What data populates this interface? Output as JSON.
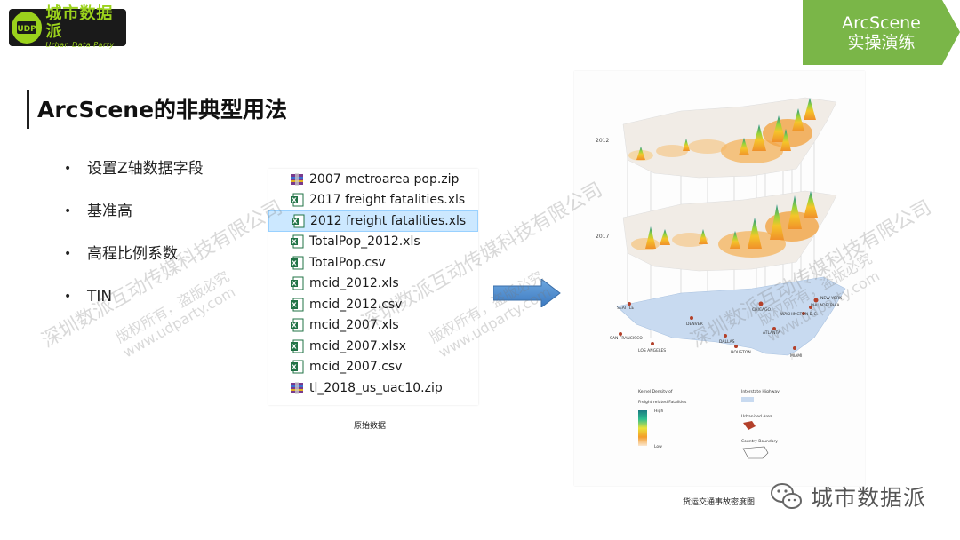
{
  "logo": {
    "cn": "城市数据派",
    "en": "Urban Data Party",
    "mark": "UDP"
  },
  "tag": {
    "line1": "ArcScene",
    "line2": "实操演练",
    "color": "#7ab648"
  },
  "title": "ArcScene的非典型用法",
  "bullets": [
    "设置Z轴数据字段",
    "基准高",
    "高程比例系数",
    "TIN"
  ],
  "files": [
    {
      "name": "2007 metroarea pop.zip",
      "icon": "winrar-icon"
    },
    {
      "name": "2017 freight fatalities.xls",
      "icon": "excel-icon"
    },
    {
      "name": "2012 freight fatalities.xls",
      "icon": "excel-icon",
      "selected": true
    },
    {
      "name": "TotalPop_2012.xls",
      "icon": "excel-icon"
    },
    {
      "name": "TotalPop.csv",
      "icon": "excel-csv-icon"
    },
    {
      "name": "mcid_2012.xls",
      "icon": "excel-icon"
    },
    {
      "name": "mcid_2012.csv",
      "icon": "excel-csv-icon"
    },
    {
      "name": "mcid_2007.xls",
      "icon": "excel-icon"
    },
    {
      "name": "mcid_2007.xlsx",
      "icon": "excel-csv-icon"
    },
    {
      "name": "mcid_2007.csv",
      "icon": "excel-csv-icon"
    },
    {
      "name": "tl_2018_us_uac10.zip",
      "icon": "winrar-icon"
    }
  ],
  "caption_left": "原始数据",
  "caption_right": "货运交通事故密度图",
  "map": {
    "layer_years": [
      "2012",
      "2017"
    ],
    "cities": [
      "SEATTLE",
      "SAN FRANCISCO",
      "LOS ANGELES",
      "DENVER",
      "DALLAS",
      "HOUSTON",
      "CHICAGO",
      "ATLANTA",
      "MIAMI",
      "NEW YORK",
      "PHILADELPHIA",
      "WASHINGTON D.C."
    ],
    "legend": {
      "density_title_1": "Kernel Density of",
      "density_title_2": "Freight related Fatalities",
      "high": "High",
      "low": "Low",
      "highway": "Interstate Highway",
      "urban": "Urbanized Area",
      "boundary": "Country Boundary"
    }
  },
  "watermarks": {
    "company": "深圳数派互动传媒科技有限公司",
    "rights": "版权所有，盗版必究",
    "url": "www.udparty.com"
  },
  "wechat": {
    "name": "城市数据派",
    "icon": "wechat-icon"
  }
}
